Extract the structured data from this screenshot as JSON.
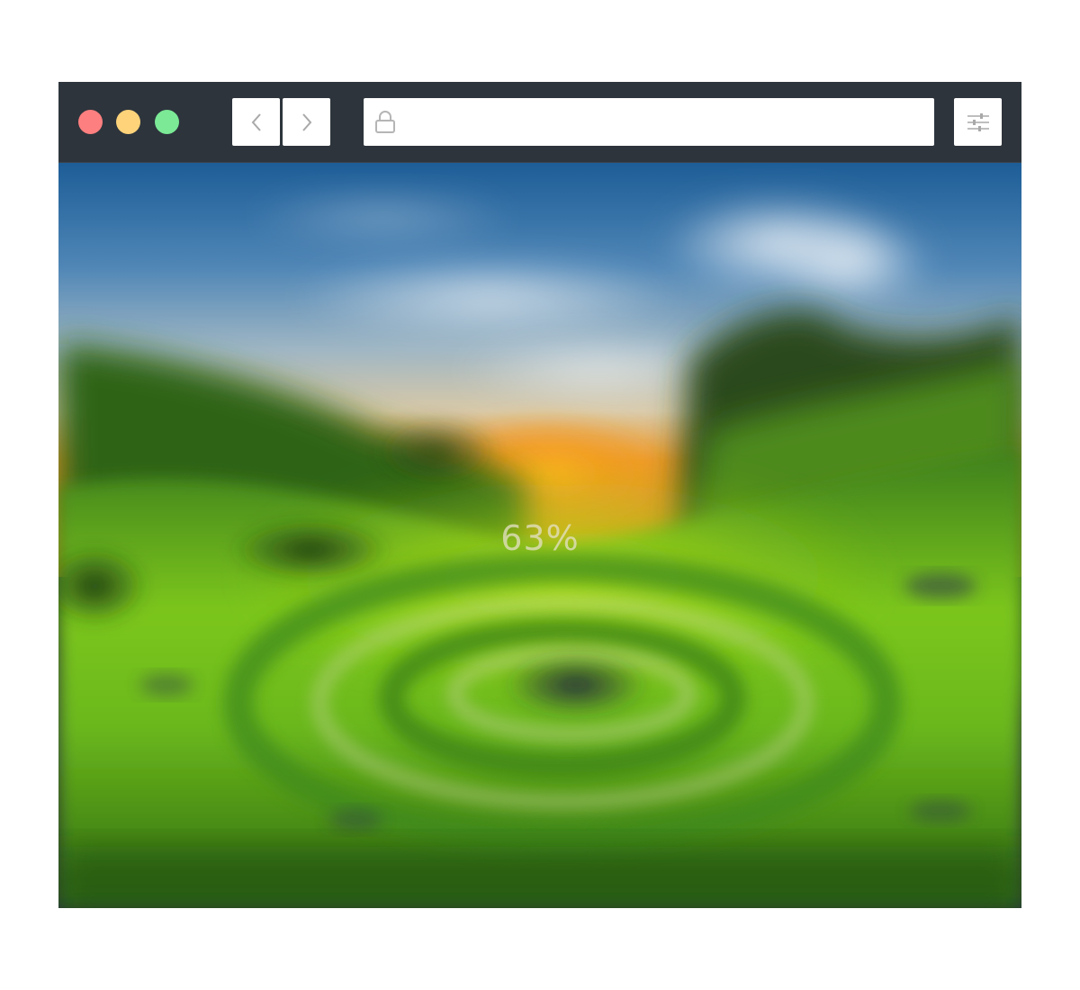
{
  "window": {
    "controls": [
      {
        "name": "close",
        "color": "#fd7f7f"
      },
      {
        "name": "minimize",
        "color": "#fed37a"
      },
      {
        "name": "zoom",
        "color": "#7be996"
      }
    ]
  },
  "toolbar": {
    "back_icon": "chevron-left-icon",
    "forward_icon": "chevron-right-icon",
    "settings_icon": "sliders-icon",
    "lock_icon": "lock-icon"
  },
  "address_bar": {
    "value": "",
    "placeholder": ""
  },
  "page": {
    "loading_progress": 0.63,
    "progress_label": "63%"
  }
}
